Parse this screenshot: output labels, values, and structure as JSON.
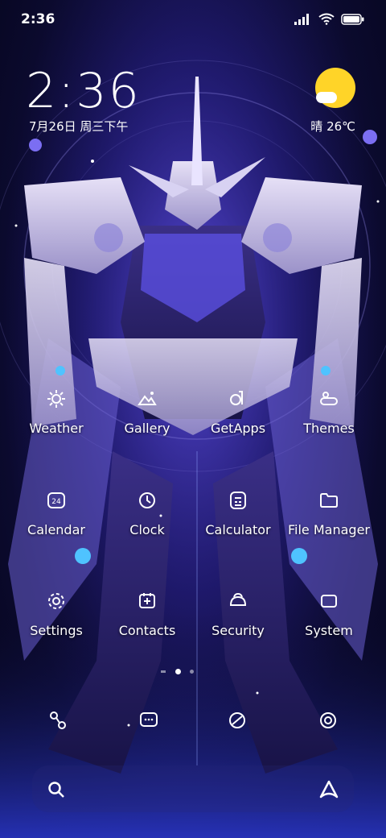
{
  "status_bar": {
    "time": "2:36",
    "signal_icon": "signal-icon",
    "wifi_icon": "wifi-icon",
    "battery_icon": "battery-icon"
  },
  "lock_widget": {
    "time": "2:36",
    "date": "7月26日 周三下午",
    "weather": "晴 26℃",
    "weather_icon": "sunny-cloud-icon"
  },
  "apps": [
    {
      "label": "Weather",
      "icon": "weather-icon"
    },
    {
      "label": "Gallery",
      "icon": "gallery-icon"
    },
    {
      "label": "GetApps",
      "icon": "getapps-icon"
    },
    {
      "label": "Themes",
      "icon": "themes-icon"
    },
    {
      "label": "Calendar",
      "icon": "calendar-icon",
      "badge": "24"
    },
    {
      "label": "Clock",
      "icon": "clock-icon"
    },
    {
      "label": "Calculator",
      "icon": "calculator-icon"
    },
    {
      "label": "File Manager",
      "icon": "folder-icon"
    },
    {
      "label": "Settings",
      "icon": "gear-icon"
    },
    {
      "label": "Contacts",
      "icon": "contacts-icon"
    },
    {
      "label": "Security",
      "icon": "security-icon"
    },
    {
      "label": "System",
      "icon": "system-icon"
    }
  ],
  "dock": [
    {
      "name": "phone",
      "icon": "phone-icon"
    },
    {
      "name": "messages",
      "icon": "messages-icon"
    },
    {
      "name": "browser",
      "icon": "browser-icon"
    },
    {
      "name": "camera",
      "icon": "camera-icon"
    }
  ],
  "page_indicator": {
    "pages": 3,
    "current": 2
  },
  "search": {
    "icon": "search-icon",
    "assistant_icon": "assistant-icon"
  },
  "colors": {
    "accent": "#4a3bd6",
    "sun": "#ffd428",
    "background_dark": "#0b0a2e"
  }
}
